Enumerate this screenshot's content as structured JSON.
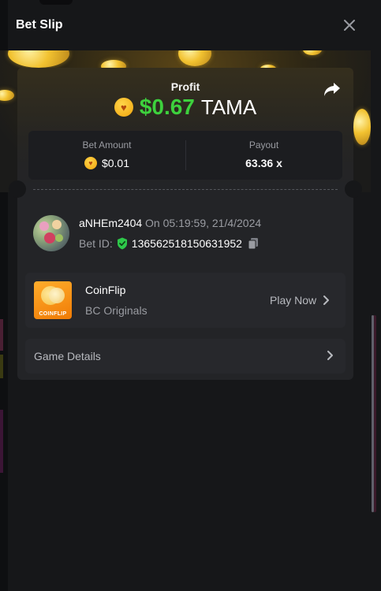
{
  "header": {
    "title": "Bet Slip"
  },
  "profit": {
    "label": "Profit",
    "value": "$0.67",
    "currency": "TAMA"
  },
  "bet_amount": {
    "label": "Bet Amount",
    "value": "$0.01"
  },
  "payout": {
    "label": "Payout",
    "value": "63.36 x"
  },
  "player": {
    "name": "aNHEm2404",
    "timestamp": "On 05:19:59, 21/4/2024",
    "bet_id_label": "Bet ID:",
    "bet_id": "136562518150631952"
  },
  "game": {
    "name": "CoinFlip",
    "provider": "BC Originals",
    "thumb_text": "COINFLIP",
    "play_label": "Play Now"
  },
  "details": {
    "label": "Game Details"
  },
  "icons": {
    "close": "close-icon",
    "share": "share-icon",
    "coin": "tama-coin-icon",
    "verified": "shield-check-icon",
    "copy": "copy-icon",
    "chevron": "chevron-right-icon"
  },
  "colors": {
    "profit_green": "#3dd13d",
    "coin_gold": "#f2a40c",
    "panel": "#232427",
    "background": "#161719"
  }
}
